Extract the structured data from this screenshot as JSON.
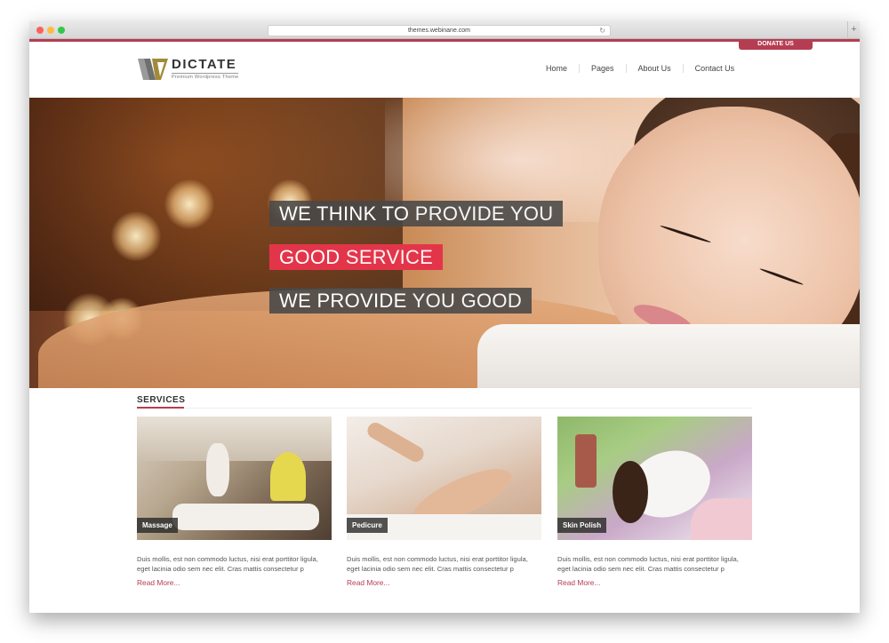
{
  "browser": {
    "url": "themes.webinane.com",
    "new_tab_label": "+"
  },
  "header": {
    "donate_label": "DONATE US",
    "logo": {
      "name": "DICTATE",
      "tagline": "Premium Wordpress Theme"
    },
    "nav": [
      "Home",
      "Pages",
      "About Us",
      "Contact Us"
    ]
  },
  "hero": {
    "line1_bold": "WE THINK TO",
    "line1_light": "PROVIDE YOU",
    "line2_bold": "GOOD",
    "line2_light": "SERVICE",
    "line3_bold": "WE PROVIDE",
    "line3_light": "YOU GOOD"
  },
  "services": {
    "title": "SERVICES",
    "items": [
      {
        "label": "Massage",
        "description": "Duis mollis, est non commodo luctus, nisi erat porttitor ligula, eget lacinia odio sem nec elit. Cras mattis consectetur p",
        "link": "Read More..."
      },
      {
        "label": "Pedicure",
        "description": "Duis mollis, est non commodo luctus, nisi erat porttitor ligula, eget lacinia odio sem nec elit. Cras mattis consectetur p",
        "link": "Read More..."
      },
      {
        "label": "Skin Polish",
        "description": "Duis mollis, est non commodo luctus, nisi erat porttitor ligula, eget lacinia odio sem nec elit. Cras mattis consectetur p",
        "link": "Read More..."
      }
    ]
  },
  "colors": {
    "accent": "#b53d52",
    "hero_highlight": "#e3354a",
    "hero_dark": "#484848"
  }
}
